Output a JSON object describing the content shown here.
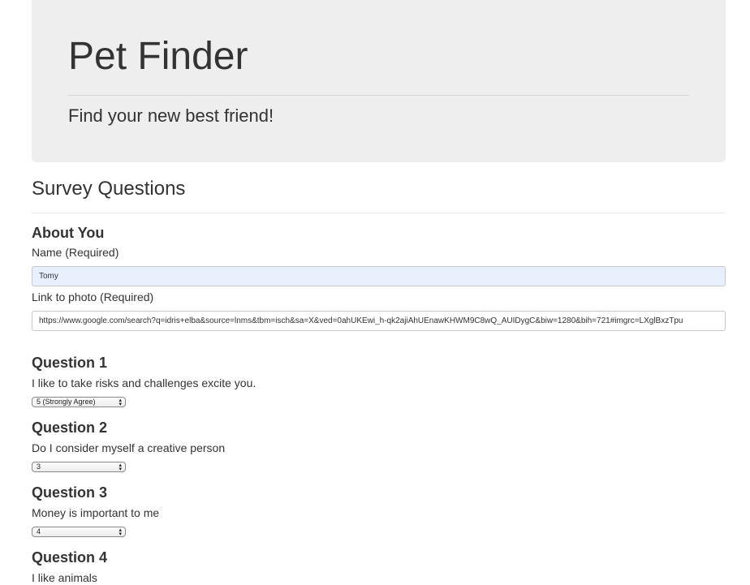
{
  "header": {
    "title": "Pet Finder",
    "tagline": "Find your new best friend!"
  },
  "survey": {
    "heading": "Survey Questions",
    "about": {
      "heading": "About You",
      "name_label": "Name (Required)",
      "name_value": "Tomy",
      "photo_label": "Link to photo (Required)",
      "photo_value": "https://www.google.com/search?q=idris+elba&source=lnms&tbm=isch&sa=X&ved=0ahUKEwi_h-qk2ajiAhUEnawKHWM9C8wQ_AUIDygC&biw=1280&bih=721#imgrc=LXglBxzTpu"
    },
    "questions": [
      {
        "heading": "Question 1",
        "text": "I like to take risks and challenges excite you.",
        "selected": "5 (Strongly Agree)"
      },
      {
        "heading": "Question 2",
        "text": "Do I consider myself a creative person",
        "selected": "3"
      },
      {
        "heading": "Question 3",
        "text": "Money is important to me",
        "selected": "4"
      },
      {
        "heading": "Question 4",
        "text": "I like animals",
        "selected": ""
      }
    ]
  },
  "icons": {
    "select_arrows": "up-down-chevron-icon"
  }
}
